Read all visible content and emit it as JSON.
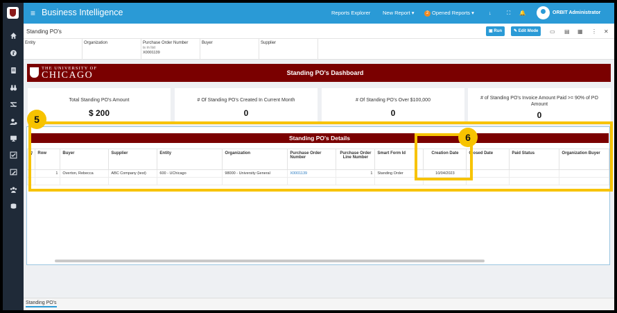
{
  "app": {
    "title": "Business Intelligence",
    "menu_glyph": "≡"
  },
  "topbar": {
    "reports_explorer": "Reports Explorer",
    "new_report": "New Report",
    "opened_reports": "Opened Reports",
    "opened_count": "2",
    "user_name": "ORBIT Administrator"
  },
  "sidebar": {
    "items": [
      "home-icon",
      "report-icon",
      "book-icon",
      "binoculars-icon",
      "shuffle-icon",
      "users-gear-icon",
      "monitor-icon",
      "checklist-icon",
      "pen-board-icon",
      "group-icon",
      "sql-icon"
    ]
  },
  "page": {
    "title": "Standing PO's",
    "run_label": "Run",
    "edit_mode_label": "Edit Mode"
  },
  "filters": [
    {
      "label": "Entity",
      "sub": "",
      "value": ""
    },
    {
      "label": "Organization",
      "sub": "",
      "value": ""
    },
    {
      "label": "Purchase Order Number",
      "sub": "is in list",
      "value": "X0001139"
    },
    {
      "label": "Buyer",
      "sub": "",
      "value": ""
    },
    {
      "label": "Supplier",
      "sub": "",
      "value": ""
    }
  ],
  "banner": {
    "logo_line1": "THE UNIVERSITY OF",
    "logo_line2": "CHICAGO",
    "title": "Standing PO's Dashboard"
  },
  "kpis": [
    {
      "label": "Total Standing PO's Amount",
      "value": "$ 200"
    },
    {
      "label": "# Of Standing PO's Created In Current Month",
      "value": "0"
    },
    {
      "label": "# Of Standing PO's Over $100,000",
      "value": "0"
    },
    {
      "label": "# of Standing PO's Invoice Amount Paid >= 90% of PO Amount",
      "value": "0"
    }
  ],
  "details": {
    "title": "Standing PO's Details",
    "columns": [
      "",
      "Row",
      "Buyer",
      "Supplier",
      "Entity",
      "Organization",
      "Purchase Order Number",
      "Purchase Order Line Number",
      "Smart Form Id",
      "Creation Date",
      "Closed Date",
      "Paid Status",
      "Organization Buyer"
    ],
    "rows": [
      [
        "",
        "1",
        "Overton, Rebecca",
        "ABC Company (test)",
        "600 - UChicago",
        "98000 - University General",
        "X0001139",
        "1",
        "Standing Order",
        "10/04/2023",
        "",
        "",
        ""
      ],
      [
        "",
        "",
        "",
        "",
        "",
        "",
        "",
        "",
        "",
        "",
        "",
        "",
        ""
      ]
    ]
  },
  "footer": {
    "tab_label": "Standing PO's"
  },
  "callouts": [
    {
      "number": "5"
    },
    {
      "number": "6"
    }
  ]
}
